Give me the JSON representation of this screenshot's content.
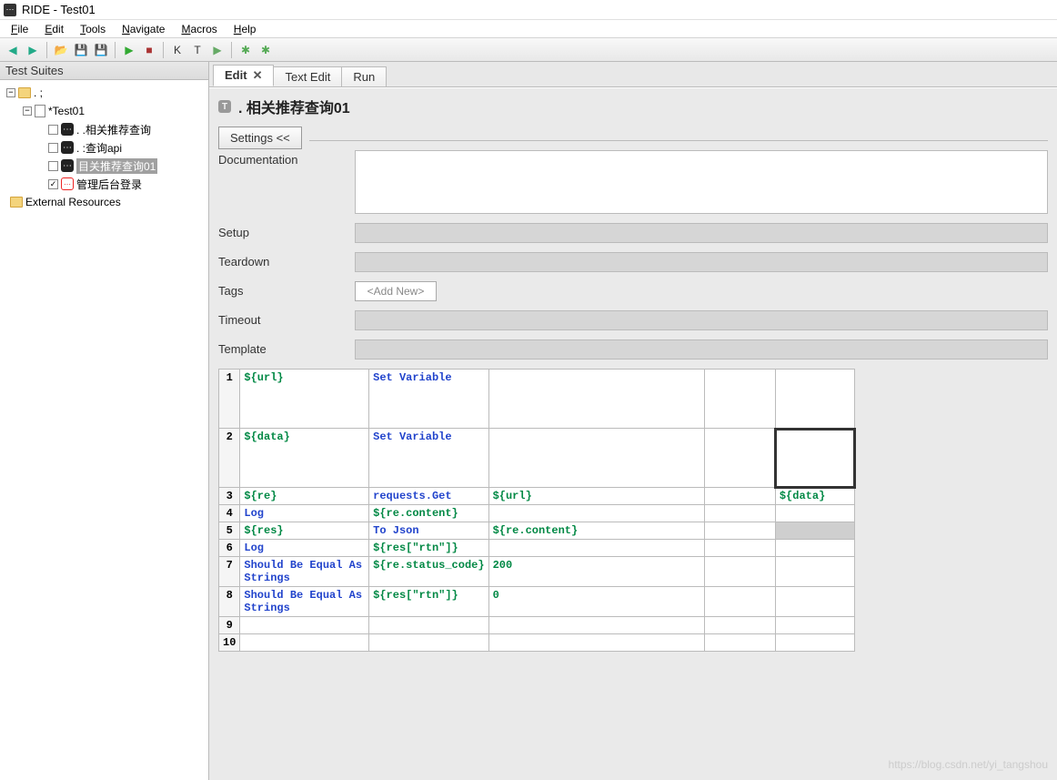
{
  "window": {
    "title": "RIDE - Test01"
  },
  "menubar": [
    {
      "label": "File",
      "accel": "F"
    },
    {
      "label": "Edit",
      "accel": "E"
    },
    {
      "label": "Tools",
      "accel": "T"
    },
    {
      "label": "Navigate",
      "accel": "N"
    },
    {
      "label": "Macros",
      "accel": "M"
    },
    {
      "label": "Help",
      "accel": "H"
    }
  ],
  "toolbar": [
    {
      "name": "back",
      "glyph": "◀",
      "color": "#2a8"
    },
    {
      "name": "forward",
      "glyph": "▶",
      "color": "#2a8"
    },
    {
      "name": "open",
      "glyph": "📂",
      "color": "#d9a43a"
    },
    {
      "name": "save",
      "glyph": "💾",
      "color": "#357"
    },
    {
      "name": "save2",
      "glyph": "💾",
      "color": "#357"
    },
    {
      "name": "play-green",
      "glyph": "▶",
      "color": "#3a3"
    },
    {
      "name": "stop",
      "glyph": "■",
      "color": "#a33"
    },
    {
      "name": "keyword-k",
      "glyph": "K",
      "color": "#333"
    },
    {
      "name": "text-t",
      "glyph": "T",
      "color": "#333"
    },
    {
      "name": "play2",
      "glyph": "▶",
      "color": "#6a6"
    },
    {
      "name": "debug",
      "glyph": "✱",
      "color": "#5a5"
    },
    {
      "name": "debug2",
      "glyph": "✱",
      "color": "#5a5"
    }
  ],
  "sidebar": {
    "title": "Test Suites",
    "nodes": {
      "root": ". ;",
      "suite": "*Test01",
      "cases": [
        {
          "label": ". .相关推荐查询",
          "checked": false,
          "selected": false
        },
        {
          "label": ". :查询api",
          "checked": false,
          "selected": false
        },
        {
          "label": "目关推荐查询01",
          "checked": false,
          "selected": true
        },
        {
          "label": "管理后台登录",
          "checked": true,
          "selected": false,
          "red": true
        }
      ],
      "external": "External Resources"
    }
  },
  "editor": {
    "tabs": [
      {
        "label": "Edit",
        "active": true,
        "closable": true
      },
      {
        "label": "Text Edit",
        "active": false,
        "closable": false
      },
      {
        "label": "Run",
        "active": false,
        "closable": false
      }
    ],
    "page_title": ". 相关推荐查询01",
    "settings_btn": "Settings <<",
    "fields": {
      "documentation": "Documentation",
      "setup": "Setup",
      "teardown": "Teardown",
      "tags": "Tags",
      "tags_placeholder": "<Add New>",
      "timeout": "Timeout",
      "template": "Template"
    },
    "table": [
      {
        "n": "1",
        "b": "${url}",
        "c": "Set Variable",
        "d": "",
        "e": "",
        "f": "",
        "tall": true
      },
      {
        "n": "2",
        "b": "${data}",
        "c": "Set Variable",
        "d": "",
        "e": "",
        "f": "",
        "tall": true,
        "f_selected": true
      },
      {
        "n": "3",
        "b": "${re}",
        "c": "requests.Get",
        "d": "${url}",
        "e": "",
        "f": "${data}"
      },
      {
        "n": "4",
        "b": "Log",
        "c": "${re.content}",
        "d": "",
        "e": "",
        "f": "",
        "kw_b": true,
        "c_var": true
      },
      {
        "n": "5",
        "b": "${res}",
        "c": "To Json",
        "d": "${re.content}",
        "e": "",
        "f": "",
        "f_grey": true
      },
      {
        "n": "6",
        "b": "Log",
        "c": "${res[\"rtn\"]}",
        "d": "",
        "e": "",
        "f": "",
        "kw_b": true,
        "c_var": true
      },
      {
        "n": "7",
        "b": "Should Be Equal As Strings",
        "c": "${re.status_code}",
        "d": "200",
        "e": "",
        "f": "",
        "kw_b": true,
        "c_var": true
      },
      {
        "n": "8",
        "b": "Should Be Equal As Strings",
        "c": "${res[\"rtn\"]}",
        "d": "0",
        "e": "",
        "f": "",
        "kw_b": true,
        "c_var": true
      },
      {
        "n": "9",
        "b": "",
        "c": "",
        "d": "",
        "e": "",
        "f": ""
      },
      {
        "n": "10",
        "b": "",
        "c": "",
        "d": "",
        "e": "",
        "f": ""
      }
    ]
  },
  "watermark": "https://blog.csdn.net/yi_tangshou"
}
